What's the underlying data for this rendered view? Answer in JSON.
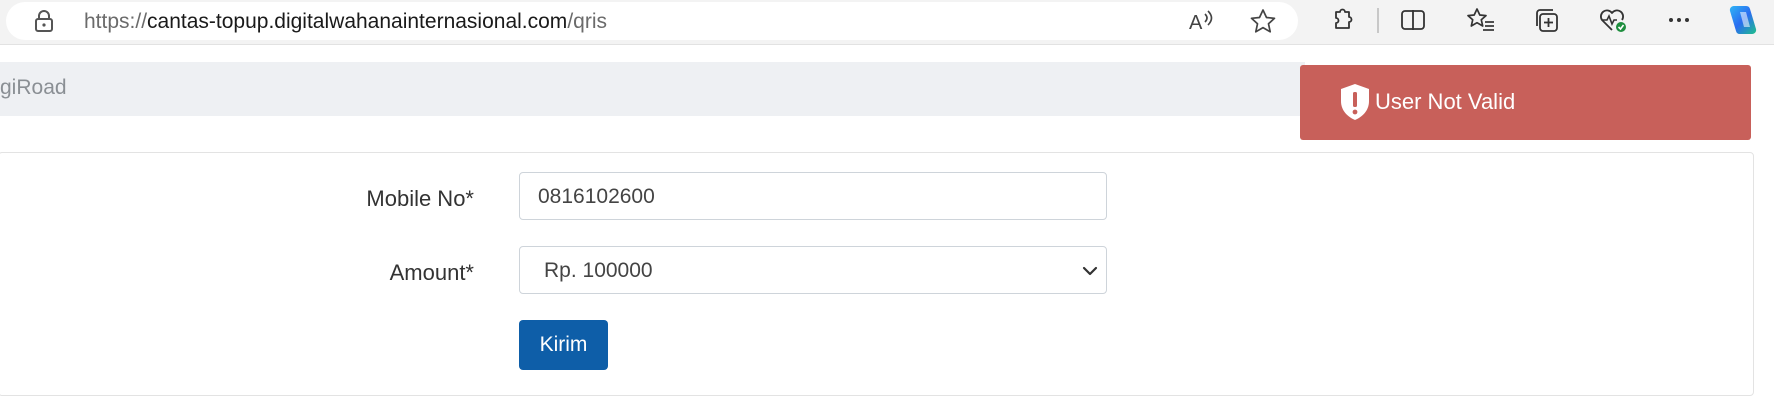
{
  "browser": {
    "url_scheme": "https://",
    "url_host": "cantas-topup.digitalwahanainternasional.com",
    "url_path": "/qris",
    "icons": [
      "lock-icon",
      "read-aloud-icon",
      "favorite-star-icon",
      "extensions-icon",
      "split-screen-icon",
      "favorites-icon",
      "collections-icon",
      "browser-essentials-icon",
      "more-icon",
      "copilot-icon"
    ]
  },
  "navbar": {
    "brand": "giRoad"
  },
  "form": {
    "mobile_label": "Mobile No*",
    "mobile_value": "0816102600",
    "amount_label": "Amount*",
    "amount_value": "Rp. 100000",
    "submit_label": "Kirim"
  },
  "toast": {
    "message": "User Not Valid"
  },
  "colors": {
    "toast_bg": "#c8605a",
    "button_bg": "#0e5ea8",
    "navbar_bg": "#eef0f3"
  }
}
